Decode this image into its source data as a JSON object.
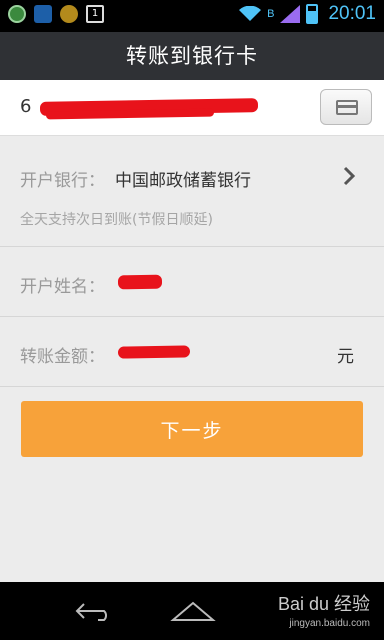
{
  "status_bar": {
    "time": "20:01",
    "network_letter": "B",
    "notification_icon_4": "1"
  },
  "header": {
    "title": "转账到银行卡"
  },
  "card": {
    "number_visible": "6"
  },
  "bank": {
    "label": "开户银行：",
    "name": "中国邮政储蓄银行",
    "note": "全天支持次日到账(节假日顺延)"
  },
  "account_name": {
    "label": "开户姓名："
  },
  "amount": {
    "label": "转账金额：",
    "unit": "元"
  },
  "next_button": {
    "label": "下一步"
  },
  "watermark": {
    "main": "Bai du 经验",
    "sub": "jingyan.baidu.com"
  },
  "colors": {
    "accent": "#f7a23a",
    "title_bar": "#2f3135",
    "redaction": "#e8131b",
    "status_blue": "#4fc3f7"
  }
}
